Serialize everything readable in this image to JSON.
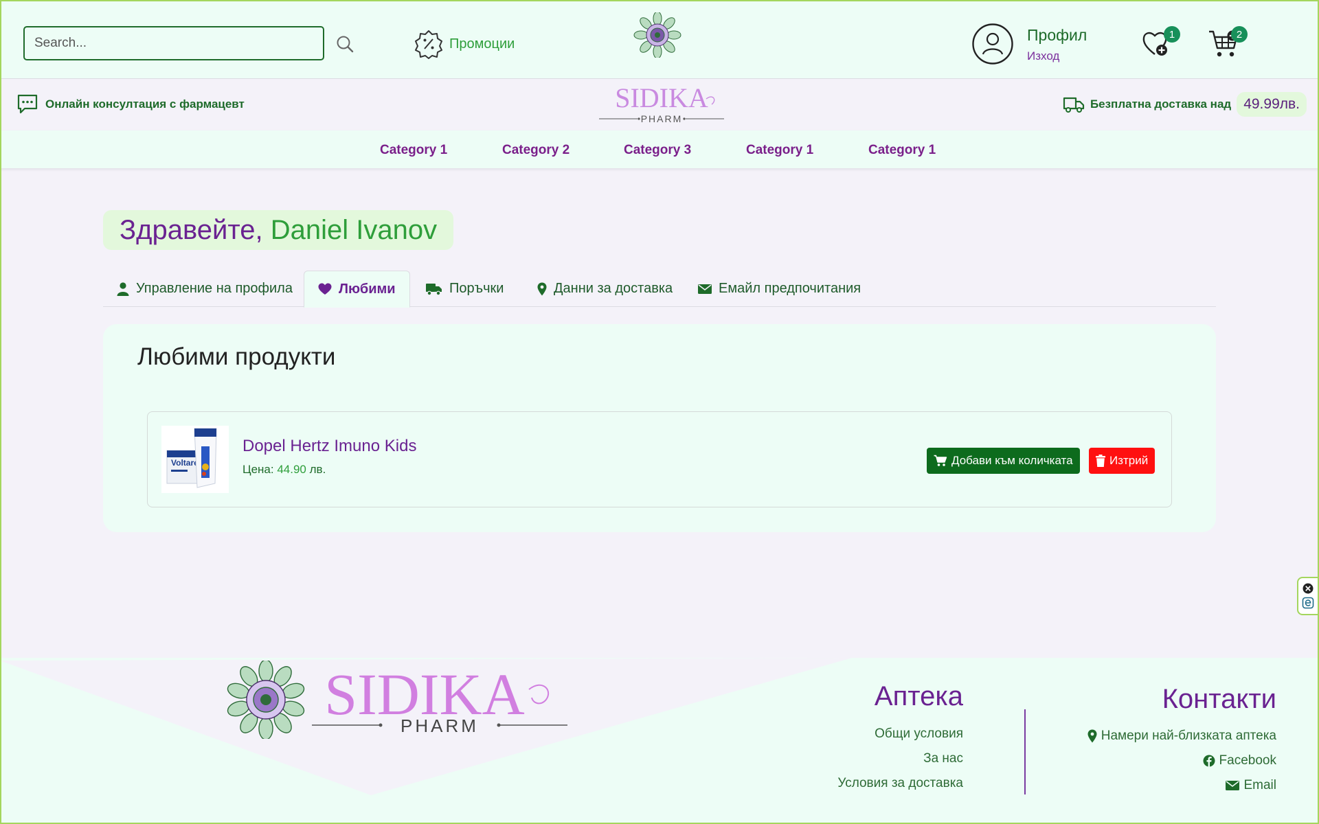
{
  "header": {
    "search_placeholder": "Search...",
    "promotions_label": "Промоции",
    "profile_title": "Профил",
    "logout_label": "Изход",
    "wishlist_count": "1",
    "cart_count": "2"
  },
  "infobar": {
    "consultation_label": "Онлайн консултация с фармацевт",
    "free_delivery_label": "Безплатна доставка над",
    "free_delivery_amount": "49.99лв."
  },
  "brand": {
    "name": "SIDIKA",
    "tagline": "PHARM"
  },
  "categories": [
    "Category 1",
    "Category 2",
    "Category 3",
    "Category 1",
    "Category 1"
  ],
  "greeting": {
    "word": "Здравейте,",
    "name": "Daniel Ivanov"
  },
  "tabs": [
    {
      "label": "Управление на профила",
      "icon": "user-icon"
    },
    {
      "label": "Любими",
      "icon": "heart-icon",
      "active": true
    },
    {
      "label": "Поръчки",
      "icon": "truck-icon"
    },
    {
      "label": "Данни за доставка",
      "icon": "map-pin-icon"
    },
    {
      "label": "Емайл предпочитания",
      "icon": "envelope-icon"
    }
  ],
  "favorites": {
    "title": "Любими продукти",
    "items": [
      {
        "name": "Dopel Hertz Imuno Kids",
        "price_label": "Цена:",
        "price_value": "44.90",
        "currency": "лв.",
        "image_text": "Voltaren",
        "add_to_cart_label": "Добави към количката",
        "delete_label": "Изтрий"
      }
    ]
  },
  "footer": {
    "pharmacy": {
      "title": "Аптека",
      "links": [
        "Общи условия",
        "За нас",
        "Условия за доставка"
      ]
    },
    "contacts": {
      "title": "Контакти",
      "links": [
        {
          "label": "Намери най-близката аптека",
          "icon": "map-pin-icon"
        },
        {
          "label": "Facebook",
          "icon": "facebook-icon"
        },
        {
          "label": "Email",
          "icon": "envelope-icon"
        }
      ]
    }
  },
  "colors": {
    "brand_purple": "#6a2291",
    "brand_green": "#2e9e3a",
    "dark_green": "#1e6b2a",
    "header_bg": "#edfdf6",
    "page_bg": "#f4f2f9",
    "delete_red": "#ff1010"
  }
}
